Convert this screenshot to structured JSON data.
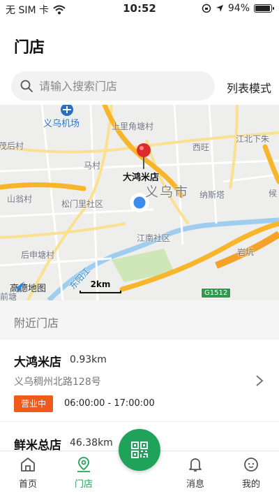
{
  "status_bar": {
    "carrier": "无 SIM 卡",
    "time": "10:52",
    "battery": "94%",
    "battery_level": 0.94
  },
  "header": {
    "title": "门店"
  },
  "search": {
    "placeholder": "请输入搜索门店",
    "value": "",
    "list_mode_label": "列表模式"
  },
  "map": {
    "labels": {
      "airport": "义乌机场",
      "shangfu": "上里角塘村",
      "xishi": "茂后村",
      "malin": "马村",
      "xiwei": "西旺",
      "jiangbei": "江北下朱",
      "store": "大鸿米店",
      "city": "义乌市",
      "shanweng": "山翁村",
      "songmen": "松门里社区",
      "nasita": "纳斯塔",
      "jiangnan": "江南社区",
      "yanshan": "岩坑",
      "houshen": "后申塘村",
      "river": "东阳江",
      "qianhe": "前塘",
      "hou": "候"
    },
    "brand": "高德地图",
    "scale": "2km",
    "road_shield": "G1512"
  },
  "nearby": {
    "title": "附近门店"
  },
  "stores": [
    {
      "name": "大鸿米店",
      "distance": "0.93km",
      "address": "义乌稠州北路128号",
      "status": "营业中",
      "hours": "06:00:00 - 17:00:00"
    },
    {
      "name": "鲜米总店",
      "distance": "46.38km"
    }
  ],
  "tabbar": {
    "items": [
      {
        "label": "首页",
        "icon": "home-icon"
      },
      {
        "label": "门店",
        "icon": "store-location-icon",
        "active": true
      },
      {
        "label": "消息",
        "icon": "bell-icon"
      },
      {
        "label": "我的",
        "icon": "profile-icon"
      }
    ],
    "scan_icon": "qr-scan-icon"
  },
  "colors": {
    "accent": "#1fa35a",
    "status_open": "#f05a1a",
    "road_major": "#f7b52c",
    "road_minor": "#fbe18f",
    "water": "#9fcdf0",
    "park": "#cfe6b8"
  }
}
